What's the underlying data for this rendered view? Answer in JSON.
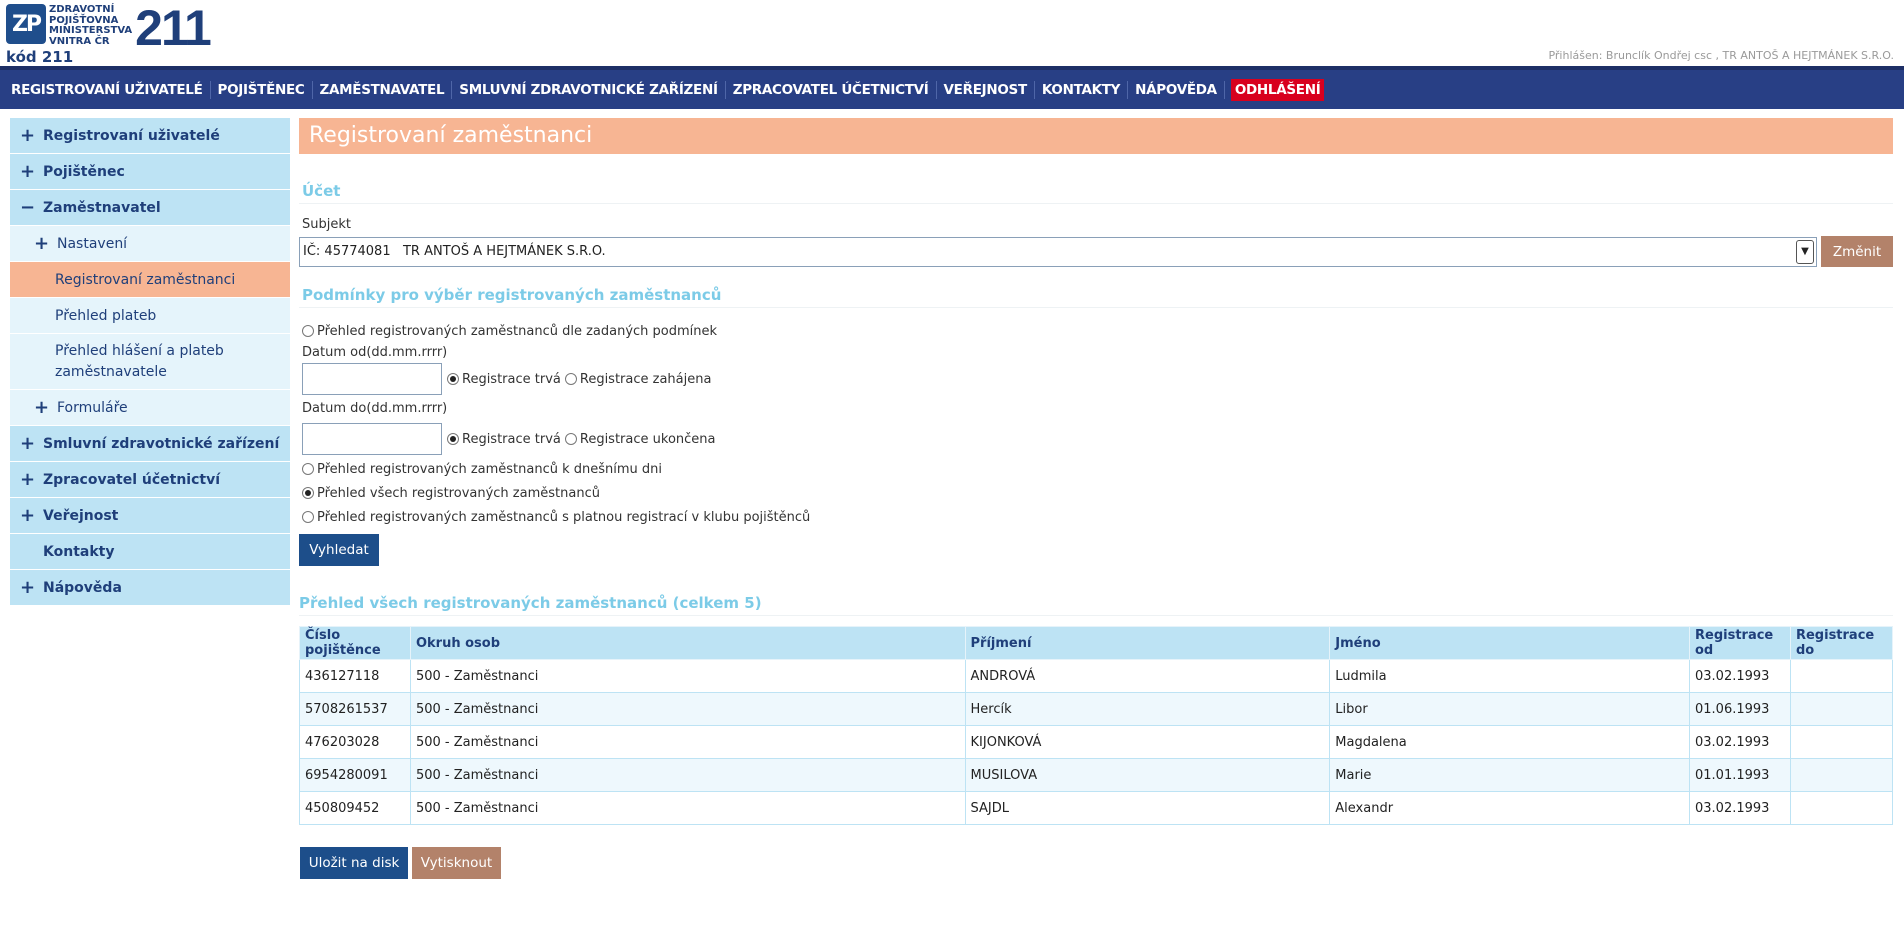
{
  "header": {
    "logo_mark": "ZP",
    "logo_lines": [
      "ZDRAVOTNÍ",
      "POJIŠŤOVNA",
      "MINISTERSTVA",
      "VNITRA ČR"
    ],
    "logo_number": "211",
    "kod": "kód 211",
    "login_info": "Přihlášen: Brunclík Ondřej csc , TR ANTOŠ A HEJTMÁNEK S.R.O."
  },
  "topnav": {
    "items": [
      "REGISTROVANÍ UŽIVATELÉ",
      "POJIŠTĚNEC",
      "ZAMĚSTNAVATEL",
      "SMLUVNÍ ZDRAVOTNICKÉ ZAŘÍZENÍ",
      "ZPRACOVATEL ÚČETNICTVÍ",
      "VEŘEJNOST",
      "KONTAKTY",
      "NÁPOVĚDA"
    ],
    "logout": "ODHLÁŠENÍ"
  },
  "sidebar": {
    "items": [
      {
        "label": "Registrovaní uživatelé",
        "icon": "+"
      },
      {
        "label": "Pojištěnec",
        "icon": "+"
      },
      {
        "label": "Zaměstnavatel",
        "icon": "−"
      },
      {
        "label": "Nastavení",
        "icon": "+"
      },
      {
        "label": "Registrovaní zaměstnanci"
      },
      {
        "label": "Přehled plateb"
      },
      {
        "label": "Přehled hlášení a plateb zaměstnavatele"
      },
      {
        "label": "Formuláře",
        "icon": "+"
      },
      {
        "label": "Smluvní zdravotnické zařízení",
        "icon": "+"
      },
      {
        "label": "Zpracovatel účetnictví",
        "icon": "+"
      },
      {
        "label": "Veřejnost",
        "icon": "+"
      },
      {
        "label": "Kontakty"
      },
      {
        "label": "Nápověda",
        "icon": "+"
      }
    ]
  },
  "main": {
    "title": "Registrovaní zaměstnanci",
    "account": {
      "heading": "Účet",
      "subject_label": "Subjekt",
      "subject_value": "IČ: 45774081   TR ANTOŠ A HEJTMÁNEK S.R.O.",
      "change_button": "Změnit"
    },
    "conditions": {
      "heading": "Podmínky pro výběr registrovaných zaměstnanců",
      "opt_conditions": "Přehled registrovaných zaměstnanců dle zadaných podmínek",
      "date_from_label": "Datum od(dd.mm.rrrr)",
      "date_from_value": "",
      "from_opt1": "Registrace trvá",
      "from_opt2": "Registrace zahájena",
      "date_to_label": "Datum do(dd.mm.rrrr)",
      "date_to_value": "",
      "to_opt1": "Registrace trvá",
      "to_opt2": "Registrace ukončena",
      "opt_today": "Přehled registrovaných zaměstnanců k dnešnímu dni",
      "opt_all": "Přehled všech registrovaných zaměstnanců",
      "opt_club": "Přehled registrovaných zaměstnanců s platnou registrací v klubu pojištěnců",
      "search_button": "Vyhledat"
    },
    "results": {
      "heading": "Přehled všech registrovaných zaměstnanců (celkem 5)",
      "columns": [
        "Číslo pojištěnce",
        "Okruh osob",
        "Příjmení",
        "Jméno",
        "Registrace od",
        "Registrace do"
      ],
      "rows": [
        [
          "436127118",
          "500 - Zaměstnanci",
          "ANDROVÁ",
          "Ludmila",
          "03.02.1993",
          ""
        ],
        [
          "5708261537",
          "500 - Zaměstnanci",
          "Hercík",
          "Libor",
          "01.06.1993",
          ""
        ],
        [
          "476203028",
          "500 - Zaměstnanci",
          "KIJONKOVÁ",
          "Magdalena",
          "03.02.1993",
          ""
        ],
        [
          "6954280091",
          "500 - Zaměstnanci",
          "MUSILOVA",
          "Marie",
          "01.01.1993",
          ""
        ],
        [
          "450809452",
          "500 - Zaměstnanci",
          "SAJDL",
          "Alexandr",
          "03.02.1993",
          ""
        ]
      ]
    },
    "save_button": "Uložit na disk",
    "print_button": "Vytisknout"
  }
}
